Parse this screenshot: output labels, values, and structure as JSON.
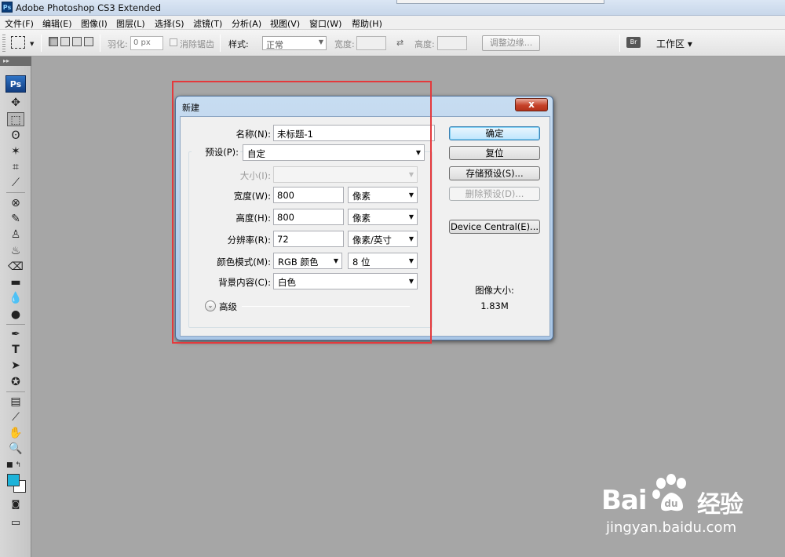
{
  "window": {
    "title": "Adobe Photoshop CS3 Extended",
    "app_icon": "Ps"
  },
  "menubar": {
    "items": [
      "文件(F)",
      "编辑(E)",
      "图像(I)",
      "图层(L)",
      "选择(S)",
      "滤镜(T)",
      "分析(A)",
      "视图(V)",
      "窗口(W)",
      "帮助(H)"
    ]
  },
  "options_bar": {
    "feather_label": "羽化:",
    "feather_value": "0 px",
    "antialias_label": "消除锯齿",
    "style_label": "样式:",
    "style_value": "正常",
    "width_label": "宽度:",
    "height_label": "高度:",
    "refine_edge_label": "调整边缘...",
    "workspace_label": "工作区 ▾"
  },
  "toolbox": {
    "logo": "Ps"
  },
  "dialog": {
    "title": "新建",
    "close_glyph": "x",
    "fields": {
      "name_label": "名称(N):",
      "name_value": "未标题-1",
      "preset_label": "预设(P):",
      "preset_value": "自定",
      "size_label": "大小(I):",
      "size_value": "",
      "width_label": "宽度(W):",
      "width_value": "800",
      "width_unit": "像素",
      "height_label": "高度(H):",
      "height_value": "800",
      "height_unit": "像素",
      "resolution_label": "分辨率(R):",
      "resolution_value": "72",
      "resolution_unit": "像素/英寸",
      "color_mode_label": "颜色模式(M):",
      "color_mode_value": "RGB 颜色",
      "bit_depth_value": "8 位",
      "background_label": "背景内容(C):",
      "background_value": "白色",
      "advanced_label": "高级"
    },
    "buttons": {
      "ok": "确定",
      "reset": "复位",
      "save_preset": "存储预设(S)...",
      "delete_preset": "删除预设(D)...",
      "device_central": "Device Central(E)..."
    },
    "image_size_label": "图像大小:",
    "image_size_value": "1.83M"
  },
  "watermark": {
    "brand_left": "Bai",
    "brand_right": "经验",
    "url": "jingyan.baidu.com"
  },
  "colors": {
    "foreground": "#1db3d9",
    "background": "#ffffff",
    "annotation": "#e4393c",
    "canvas": "#a6a6a6"
  }
}
